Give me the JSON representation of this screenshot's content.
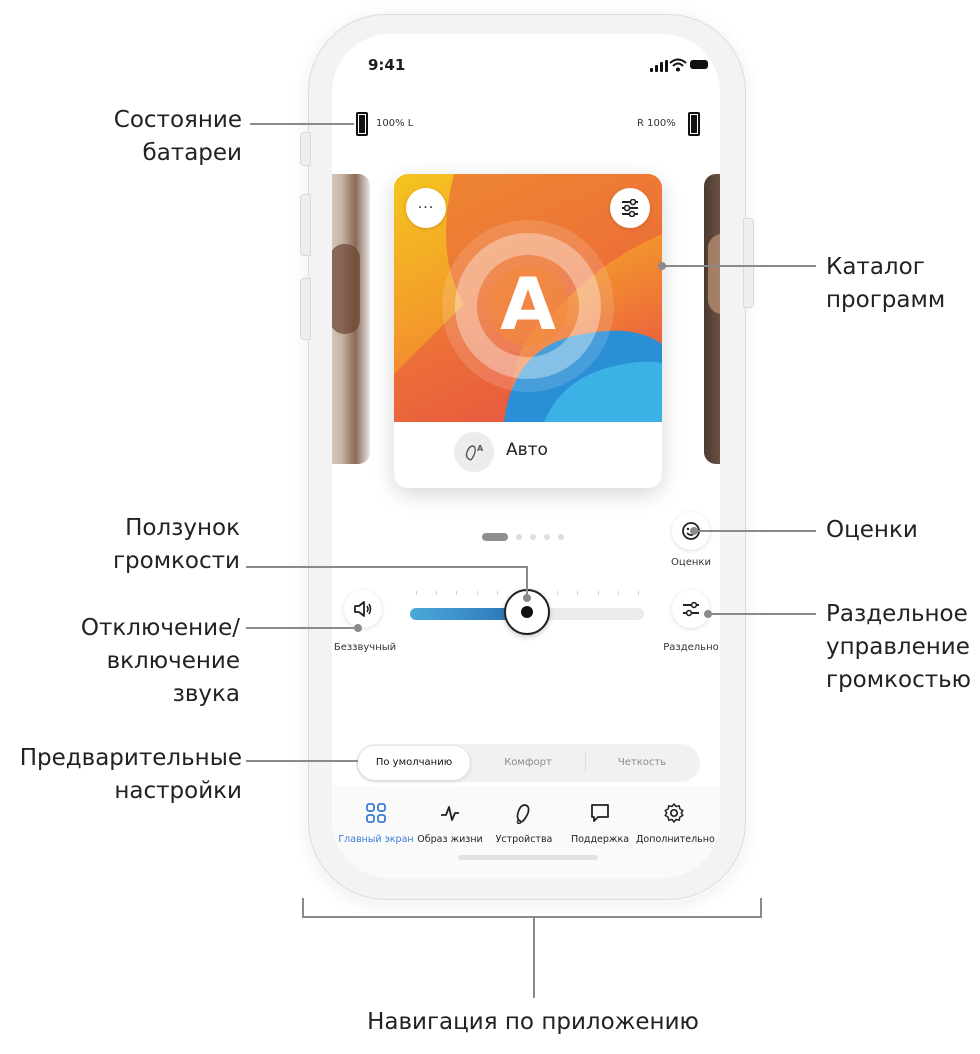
{
  "status_bar": {
    "time": "9:41"
  },
  "battery": {
    "left_label": "100% L",
    "right_label": "R 100%"
  },
  "program": {
    "name": "Авто",
    "hero_letter": "A"
  },
  "carousel": {
    "count": 5,
    "active_index": 0
  },
  "controls": {
    "ratings_label": "Оценки",
    "mute_label": "Беззвучный",
    "split_label": "Раздельно",
    "volume_fraction": 0.5
  },
  "presets": {
    "items": [
      "По умолчанию",
      "Комфорт",
      "Четкость"
    ],
    "selected_index": 0
  },
  "tabs": [
    {
      "label": "Главный экран",
      "icon": "grid-icon",
      "active": true
    },
    {
      "label": "Образ жизни",
      "icon": "pulse-icon",
      "active": false
    },
    {
      "label": "Устройства",
      "icon": "hearing-aid-icon",
      "active": false
    },
    {
      "label": "Поддержка",
      "icon": "chat-bubble-icon",
      "active": false
    },
    {
      "label": "Дополнительно",
      "icon": "gear-icon",
      "active": false
    }
  ],
  "colors": {
    "accent": "#3a7bd5",
    "slider_start": "#4aa9da",
    "slider_end": "#2a6fb3"
  },
  "callouts": {
    "battery_status": [
      "Состояние",
      "батареи"
    ],
    "program_catalog": [
      "Каталог",
      "программ"
    ],
    "volume_slider": [
      "Ползунок",
      "громкости"
    ],
    "ratings": [
      "Оценки"
    ],
    "mute_toggle": [
      "Отключение/",
      "включение звука"
    ],
    "split_volume": [
      "Раздельное",
      "управление",
      "громкостью"
    ],
    "presets": [
      "Предварительные",
      "настройки"
    ],
    "app_navigation": [
      "Навигация по приложению"
    ]
  }
}
